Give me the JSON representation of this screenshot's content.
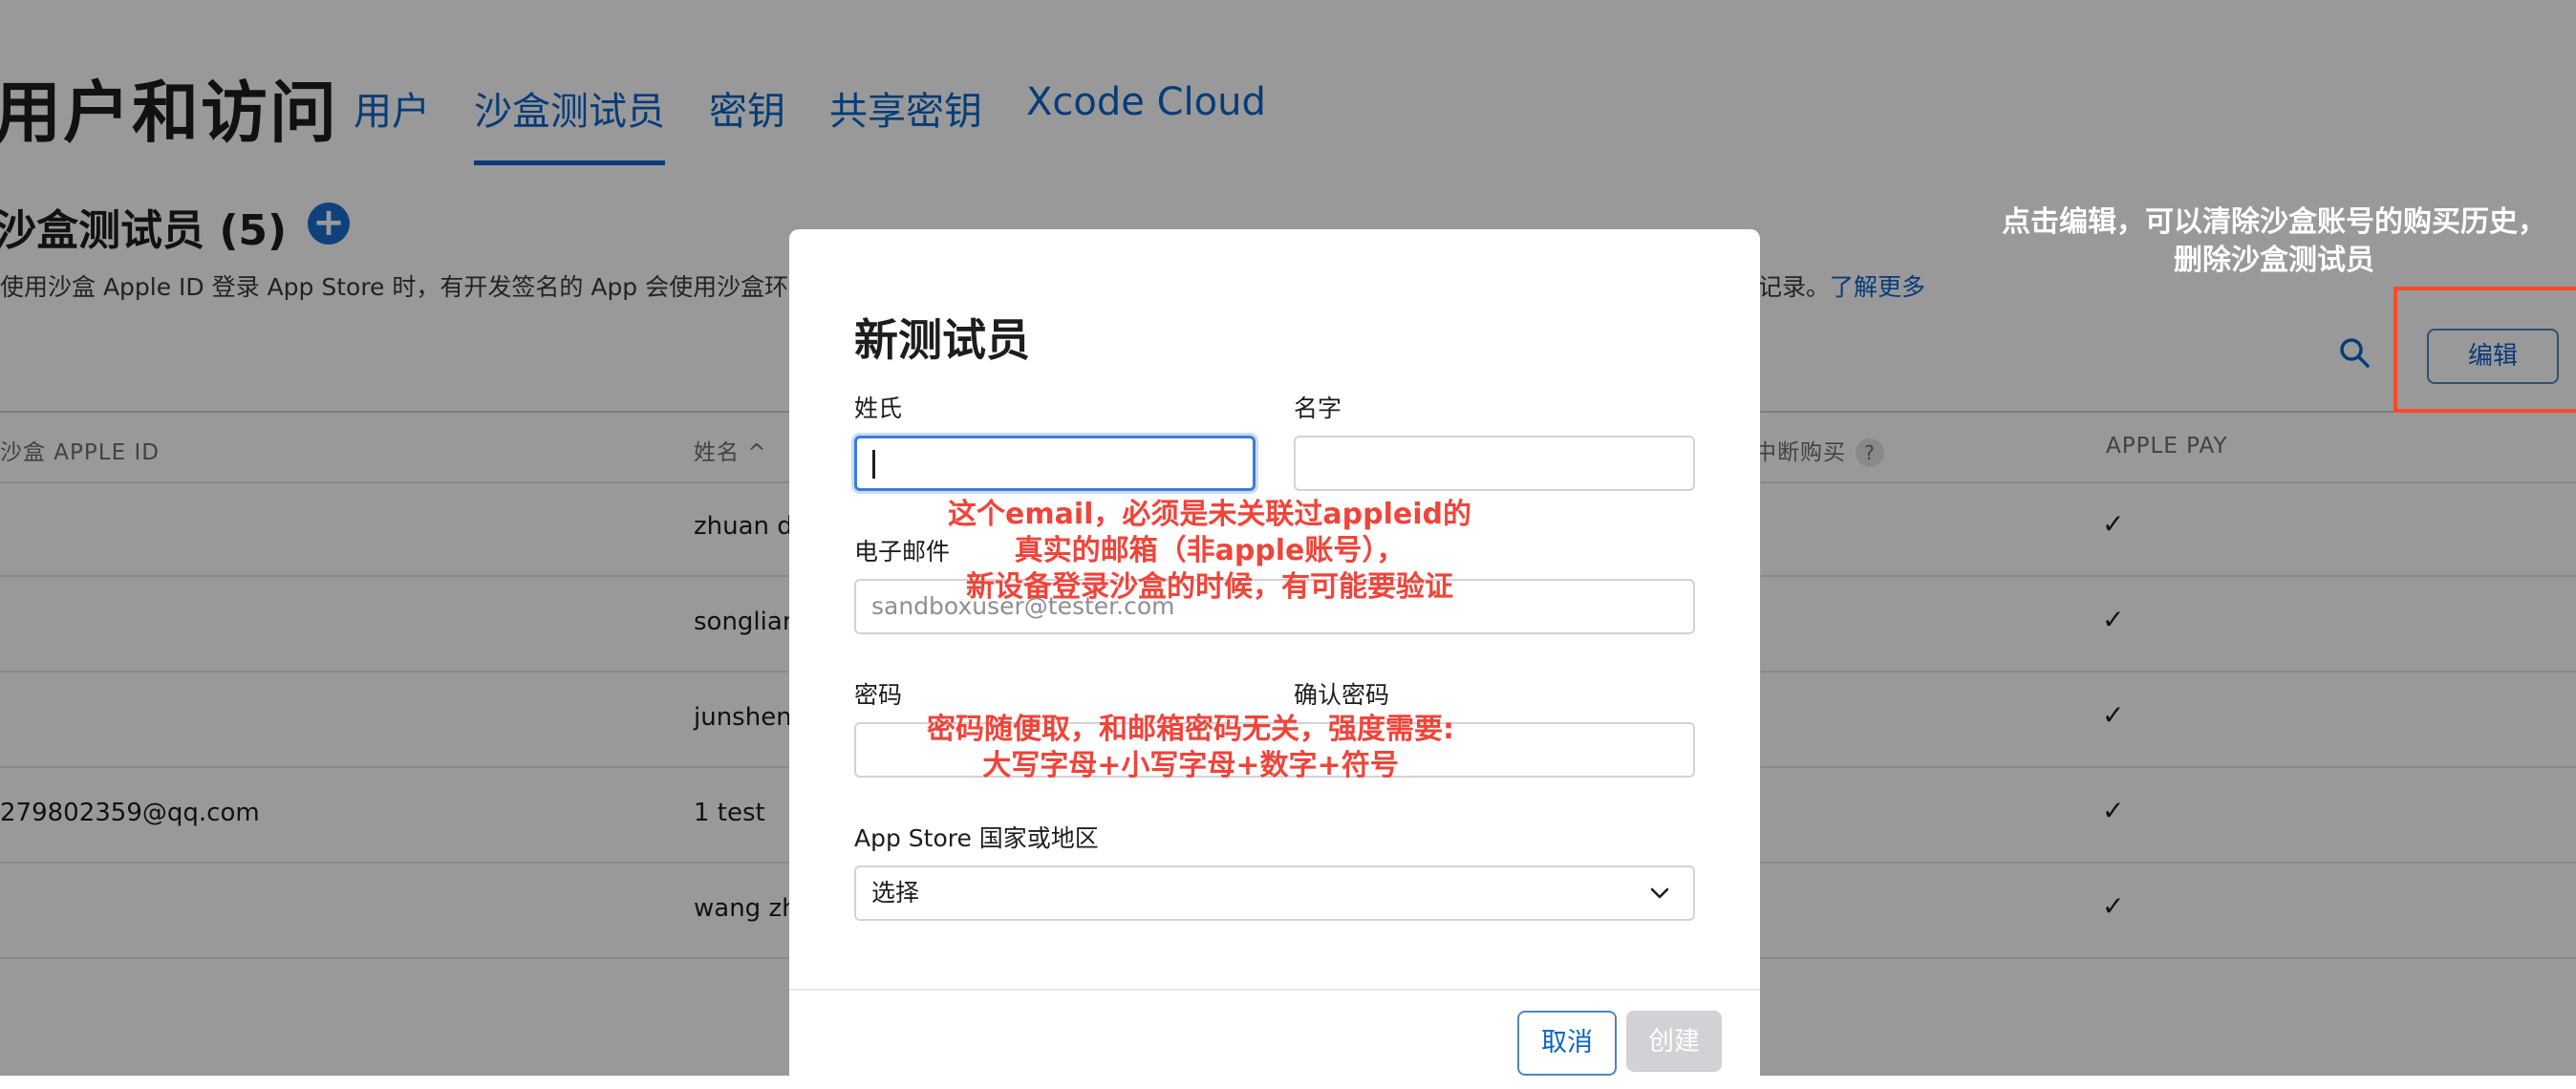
{
  "header": {
    "title": "用户和访问",
    "tabs": [
      {
        "label": "用户"
      },
      {
        "label": "沙盒测试员"
      },
      {
        "label": "密钥"
      },
      {
        "label": "共享密钥"
      },
      {
        "label": "Xcode Cloud"
      }
    ]
  },
  "section": {
    "title": "沙盒测试员 (5)",
    "add_icon": "+",
    "description": "使用沙盒 Apple ID 登录 App Store 时，有开发签名的 App 会使用沙盒环境",
    "description_tail": "记录。",
    "learn_more": "了解更多",
    "edit_label": "编辑"
  },
  "table": {
    "headers": {
      "apple_id": "沙盒 APPLE ID",
      "name": "姓名 ^",
      "interrupt": "中断购买",
      "help": "?",
      "apple_pay": "APPLE PAY"
    },
    "rows": [
      {
        "apple_id": "",
        "name": "zhuan d",
        "apple_pay": "✓"
      },
      {
        "apple_id": "",
        "name": "songlian",
        "apple_pay": "✓"
      },
      {
        "apple_id": "",
        "name": "junsheng",
        "apple_pay": "✓"
      },
      {
        "apple_id": "279802359@qq.com",
        "name": "1 test",
        "apple_pay": "✓"
      },
      {
        "apple_id": "",
        "name": "wang zh",
        "apple_pay": "✓"
      }
    ]
  },
  "modal": {
    "title": "新测试员",
    "last_name_label": "姓氏",
    "first_name_label": "名字",
    "email_label": "电子邮件",
    "email_placeholder": "sandboxuser@tester.com",
    "password_label": "密码",
    "confirm_password_label": "确认密码",
    "region_label": "App Store 国家或地区",
    "region_value": "选择",
    "cancel_label": "取消",
    "create_label": "创建"
  },
  "annotations": {
    "edit_note": [
      "点击编辑，可以清除沙盒账号的购买历史，",
      "删除沙盒测试员"
    ],
    "email_note": [
      "这个email，必须是未关联过appleid的",
      "真实的邮箱（非apple账号），",
      "新设备登录沙盒的时候，有可能要验证"
    ],
    "password_note": [
      "密码随便取，和邮箱密码无关，强度需要:",
      "大写字母+小写字母+数字+符号"
    ]
  },
  "colors": {
    "accent": "#0a64c8",
    "annotation_red": "#f0443a",
    "highlight_box": "#ff4a2a"
  }
}
